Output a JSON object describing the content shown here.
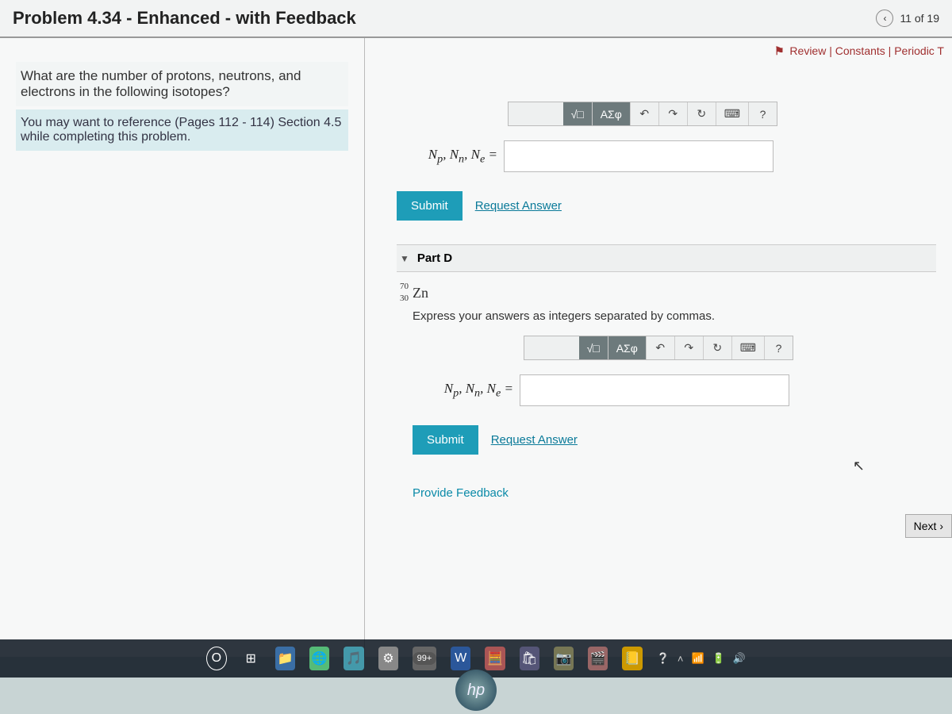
{
  "header": {
    "title": "Problem 4.34 - Enhanced - with Feedback",
    "counter": "11 of 19",
    "prev_icon": "‹"
  },
  "top_links": {
    "review": "Review",
    "constants": "Constants",
    "periodic": "Periodic T"
  },
  "left": {
    "prompt": "What are the number of protons, neutrons, and electrons in the following isotopes?",
    "hint": "You may want to reference (Pages 112 - 114) Section 4.5 while completing this problem."
  },
  "toolbar": {
    "templates": "√□",
    "greek": "ΑΣφ",
    "undo": "↶",
    "redo": "↷",
    "reset": "↻",
    "keyboard": "⌨",
    "help": "?"
  },
  "answer_c": {
    "vars_label": "Nₚ, Nₙ, Nₑ =",
    "value": ""
  },
  "part_d": {
    "label": "Part D",
    "isotope_mass": "70",
    "isotope_atomic": "30",
    "isotope_symbol": "Zn",
    "instruction": "Express your answers as integers separated by commas.",
    "vars_label": "Nₚ, Nₙ, Nₑ =",
    "value": ""
  },
  "buttons": {
    "submit": "Submit",
    "request": "Request Answer",
    "next": "Next ›",
    "feedback": "Provide Feedback"
  },
  "taskbar": {
    "search": "O",
    "task_view": "⊞",
    "badge": "99+",
    "word": "W"
  },
  "logo": "hp"
}
